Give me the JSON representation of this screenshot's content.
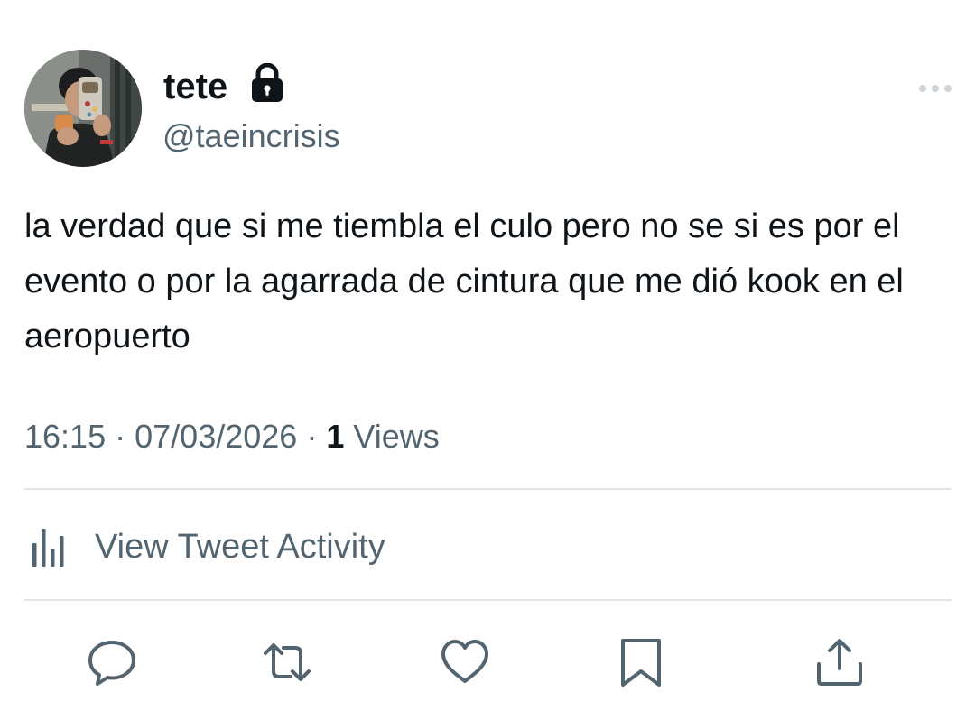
{
  "user": {
    "display_name": "tete",
    "handle": "@taeincrisis",
    "protected": true,
    "avatar_icon": "profile-photo"
  },
  "tweet": {
    "text": "la verdad que si me tiembla el culo pero no se si es por el evento o por la agarrada de cintura que me dió kook en el aeropuerto",
    "time": "16:15",
    "separator": "·",
    "date": "07/03/2026",
    "views_count": "1",
    "views_label": "Views"
  },
  "activity": {
    "label": "View Tweet Activity",
    "icon": "bar-chart-icon"
  },
  "actions": [
    {
      "name": "reply",
      "icon": "speech-bubble-icon"
    },
    {
      "name": "retweet",
      "icon": "retweet-arrows-icon"
    },
    {
      "name": "like",
      "icon": "heart-icon"
    },
    {
      "name": "bookmark",
      "icon": "bookmark-icon"
    },
    {
      "name": "share",
      "icon": "share-upload-icon"
    }
  ],
  "colors": {
    "primary_text": "#0f1419",
    "secondary_text": "#536471",
    "divider": "#e1e4e8",
    "background": "#ffffff"
  }
}
